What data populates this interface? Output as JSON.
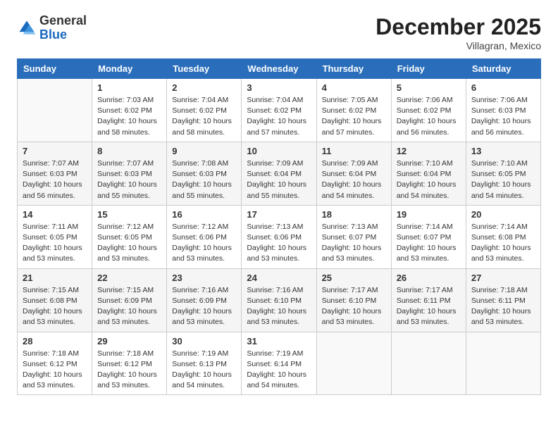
{
  "header": {
    "logo_general": "General",
    "logo_blue": "Blue",
    "month_year": "December 2025",
    "location": "Villagran, Mexico"
  },
  "days_of_week": [
    "Sunday",
    "Monday",
    "Tuesday",
    "Wednesday",
    "Thursday",
    "Friday",
    "Saturday"
  ],
  "weeks": [
    [
      {
        "day": "",
        "info": ""
      },
      {
        "day": "1",
        "info": "Sunrise: 7:03 AM\nSunset: 6:02 PM\nDaylight: 10 hours\nand 58 minutes."
      },
      {
        "day": "2",
        "info": "Sunrise: 7:04 AM\nSunset: 6:02 PM\nDaylight: 10 hours\nand 58 minutes."
      },
      {
        "day": "3",
        "info": "Sunrise: 7:04 AM\nSunset: 6:02 PM\nDaylight: 10 hours\nand 57 minutes."
      },
      {
        "day": "4",
        "info": "Sunrise: 7:05 AM\nSunset: 6:02 PM\nDaylight: 10 hours\nand 57 minutes."
      },
      {
        "day": "5",
        "info": "Sunrise: 7:06 AM\nSunset: 6:02 PM\nDaylight: 10 hours\nand 56 minutes."
      },
      {
        "day": "6",
        "info": "Sunrise: 7:06 AM\nSunset: 6:03 PM\nDaylight: 10 hours\nand 56 minutes."
      }
    ],
    [
      {
        "day": "7",
        "info": "Sunrise: 7:07 AM\nSunset: 6:03 PM\nDaylight: 10 hours\nand 56 minutes."
      },
      {
        "day": "8",
        "info": "Sunrise: 7:07 AM\nSunset: 6:03 PM\nDaylight: 10 hours\nand 55 minutes."
      },
      {
        "day": "9",
        "info": "Sunrise: 7:08 AM\nSunset: 6:03 PM\nDaylight: 10 hours\nand 55 minutes."
      },
      {
        "day": "10",
        "info": "Sunrise: 7:09 AM\nSunset: 6:04 PM\nDaylight: 10 hours\nand 55 minutes."
      },
      {
        "day": "11",
        "info": "Sunrise: 7:09 AM\nSunset: 6:04 PM\nDaylight: 10 hours\nand 54 minutes."
      },
      {
        "day": "12",
        "info": "Sunrise: 7:10 AM\nSunset: 6:04 PM\nDaylight: 10 hours\nand 54 minutes."
      },
      {
        "day": "13",
        "info": "Sunrise: 7:10 AM\nSunset: 6:05 PM\nDaylight: 10 hours\nand 54 minutes."
      }
    ],
    [
      {
        "day": "14",
        "info": "Sunrise: 7:11 AM\nSunset: 6:05 PM\nDaylight: 10 hours\nand 53 minutes."
      },
      {
        "day": "15",
        "info": "Sunrise: 7:12 AM\nSunset: 6:05 PM\nDaylight: 10 hours\nand 53 minutes."
      },
      {
        "day": "16",
        "info": "Sunrise: 7:12 AM\nSunset: 6:06 PM\nDaylight: 10 hours\nand 53 minutes."
      },
      {
        "day": "17",
        "info": "Sunrise: 7:13 AM\nSunset: 6:06 PM\nDaylight: 10 hours\nand 53 minutes."
      },
      {
        "day": "18",
        "info": "Sunrise: 7:13 AM\nSunset: 6:07 PM\nDaylight: 10 hours\nand 53 minutes."
      },
      {
        "day": "19",
        "info": "Sunrise: 7:14 AM\nSunset: 6:07 PM\nDaylight: 10 hours\nand 53 minutes."
      },
      {
        "day": "20",
        "info": "Sunrise: 7:14 AM\nSunset: 6:08 PM\nDaylight: 10 hours\nand 53 minutes."
      }
    ],
    [
      {
        "day": "21",
        "info": "Sunrise: 7:15 AM\nSunset: 6:08 PM\nDaylight: 10 hours\nand 53 minutes."
      },
      {
        "day": "22",
        "info": "Sunrise: 7:15 AM\nSunset: 6:09 PM\nDaylight: 10 hours\nand 53 minutes."
      },
      {
        "day": "23",
        "info": "Sunrise: 7:16 AM\nSunset: 6:09 PM\nDaylight: 10 hours\nand 53 minutes."
      },
      {
        "day": "24",
        "info": "Sunrise: 7:16 AM\nSunset: 6:10 PM\nDaylight: 10 hours\nand 53 minutes."
      },
      {
        "day": "25",
        "info": "Sunrise: 7:17 AM\nSunset: 6:10 PM\nDaylight: 10 hours\nand 53 minutes."
      },
      {
        "day": "26",
        "info": "Sunrise: 7:17 AM\nSunset: 6:11 PM\nDaylight: 10 hours\nand 53 minutes."
      },
      {
        "day": "27",
        "info": "Sunrise: 7:18 AM\nSunset: 6:11 PM\nDaylight: 10 hours\nand 53 minutes."
      }
    ],
    [
      {
        "day": "28",
        "info": "Sunrise: 7:18 AM\nSunset: 6:12 PM\nDaylight: 10 hours\nand 53 minutes."
      },
      {
        "day": "29",
        "info": "Sunrise: 7:18 AM\nSunset: 6:12 PM\nDaylight: 10 hours\nand 53 minutes."
      },
      {
        "day": "30",
        "info": "Sunrise: 7:19 AM\nSunset: 6:13 PM\nDaylight: 10 hours\nand 54 minutes."
      },
      {
        "day": "31",
        "info": "Sunrise: 7:19 AM\nSunset: 6:14 PM\nDaylight: 10 hours\nand 54 minutes."
      },
      {
        "day": "",
        "info": ""
      },
      {
        "day": "",
        "info": ""
      },
      {
        "day": "",
        "info": ""
      }
    ]
  ]
}
